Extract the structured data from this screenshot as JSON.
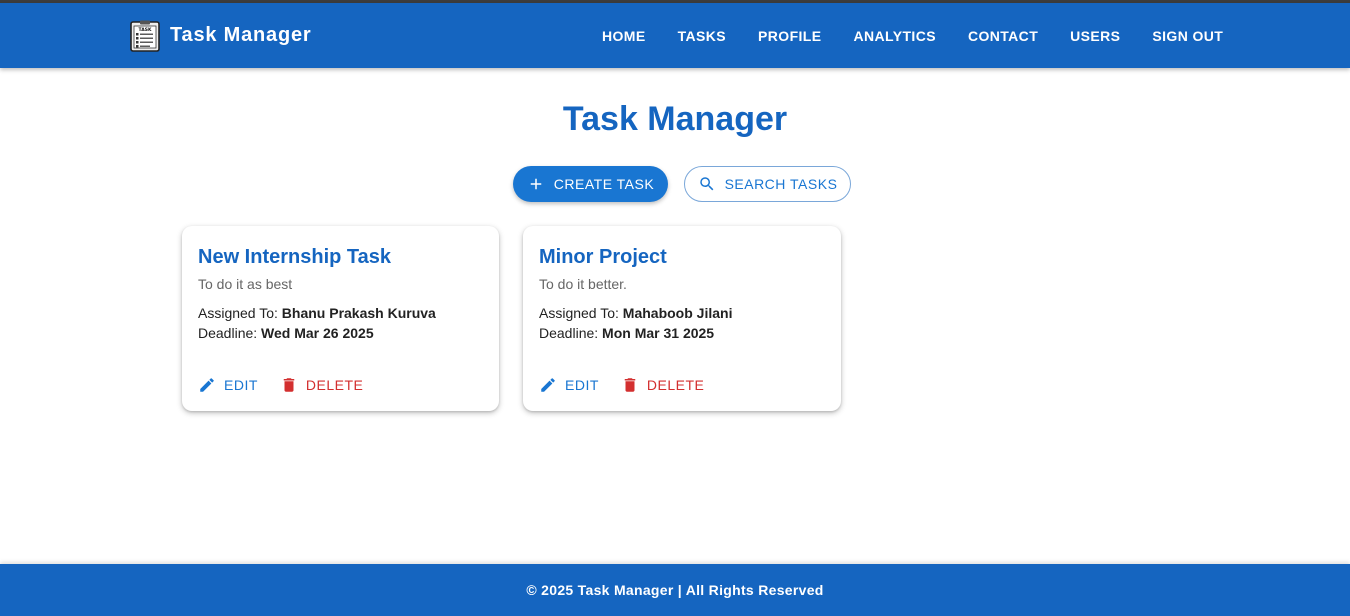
{
  "app": {
    "brand": "Task Manager"
  },
  "nav": {
    "items": [
      "HOME",
      "TASKS",
      "PROFILE",
      "ANALYTICS",
      "CONTACT",
      "USERS",
      "SIGN OUT"
    ]
  },
  "main": {
    "title": "Task Manager",
    "create_label": "CREATE TASK",
    "search_label": "SEARCH TASKS"
  },
  "tasks": [
    {
      "title": "New Internship Task",
      "description": "To do it as best",
      "assigned_label": "Assigned To: ",
      "assignee": "Bhanu Prakash Kuruva",
      "deadline_label": "Deadline: ",
      "deadline": "Wed Mar 26 2025",
      "edit_label": "EDIT",
      "delete_label": "DELETE"
    },
    {
      "title": "Minor Project",
      "description": "To do it better.",
      "assigned_label": "Assigned To: ",
      "assignee": "Mahaboob Jilani",
      "deadline_label": "Deadline: ",
      "deadline": "Mon Mar 31 2025",
      "edit_label": "EDIT",
      "delete_label": "DELETE"
    }
  ],
  "footer": {
    "text": "© 2025 Task Manager | All Rights Reserved"
  },
  "icons": {
    "logo": "task-clipboard-icon",
    "create": "plus-icon",
    "search": "search-icon",
    "edit": "pencil-icon",
    "delete": "trash-icon"
  },
  "colors": {
    "primary": "#1565c0",
    "button": "#1976d2",
    "danger": "#d32f2f"
  }
}
